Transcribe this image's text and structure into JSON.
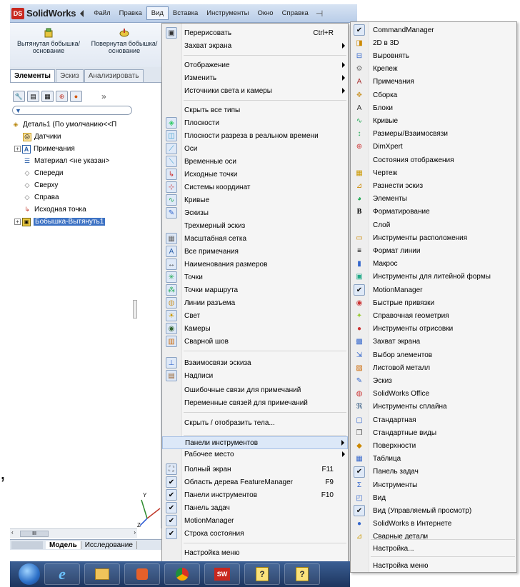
{
  "app": {
    "logo_prefix": "DS",
    "logo_name": "SolidWorks"
  },
  "menubar": {
    "items": [
      "Файл",
      "Правка",
      "Вид",
      "Вставка",
      "Инструменты",
      "Окно",
      "Справка"
    ],
    "active": "Вид"
  },
  "commands": [
    {
      "label": "Вытянутая бобышка/основание",
      "icon": "extrude-boss-icon"
    },
    {
      "label": "Повернутая бобышка/основание",
      "icon": "revolve-boss-icon"
    }
  ],
  "tabs": {
    "features": "Элементы",
    "sketch": "Эскиз",
    "analyze": "Анализировать"
  },
  "tree": {
    "root": "Деталь1  (По умолчанию<<П",
    "items": [
      {
        "label": "Датчики",
        "icon": "sensors-icon"
      },
      {
        "label": "Примечания",
        "icon": "annotations-icon"
      },
      {
        "label": "Материал <не указан>",
        "icon": "material-icon"
      },
      {
        "label": "Спереди",
        "icon": "front-plane-icon"
      },
      {
        "label": "Сверху",
        "icon": "top-plane-icon"
      },
      {
        "label": "Справа",
        "icon": "right-plane-icon"
      },
      {
        "label": "Исходная точка",
        "icon": "origin-icon"
      },
      {
        "label": "Бобышка-Вытянуть1",
        "icon": "boss-extrude-icon"
      }
    ]
  },
  "bottom_tabs": {
    "model": "Модель",
    "study": "Исследование"
  },
  "scroll_label": "III",
  "view_menu": {
    "items": [
      {
        "label": "Перерисовать",
        "shortcut": "Ctrl+R",
        "icon": "redraw-icon"
      },
      {
        "label": "Захват экрана",
        "submenu": true
      },
      {
        "label": "Отображение",
        "submenu": true
      },
      {
        "label": "Изменить",
        "submenu": true
      },
      {
        "label": "Источники света и камеры",
        "submenu": true
      },
      {
        "label": "Скрыть все типы"
      },
      {
        "label": "Плоскости",
        "icon": "planes-icon"
      },
      {
        "label": "Плоскости разреза в реальном времени",
        "icon": "section-planes-icon"
      },
      {
        "label": "Оси",
        "icon": "axes-icon"
      },
      {
        "label": "Временные оси",
        "icon": "temp-axes-icon"
      },
      {
        "label": "Исходные точки",
        "icon": "origins-icon"
      },
      {
        "label": "Системы координат",
        "icon": "coordinate-systems-icon"
      },
      {
        "label": "Кривые",
        "icon": "curves-icon"
      },
      {
        "label": "Эскизы",
        "icon": "sketches-icon"
      },
      {
        "label": "Трехмерный эскиз"
      },
      {
        "label": "Масштабная сетка",
        "icon": "grid-icon"
      },
      {
        "label": "Все примечания",
        "icon": "all-annotations-icon"
      },
      {
        "label": "Наименования размеров",
        "icon": "dimension-names-icon"
      },
      {
        "label": "Точки",
        "icon": "points-icon"
      },
      {
        "label": "Точки маршрута",
        "icon": "route-points-icon"
      },
      {
        "label": "Линии разъема",
        "icon": "parting-lines-icon"
      },
      {
        "label": "Свет",
        "icon": "lights-icon"
      },
      {
        "label": "Камеры",
        "icon": "cameras-icon"
      },
      {
        "label": "Сварной шов",
        "icon": "weld-bead-icon"
      },
      {
        "label": "Взаимосвязи эскиза",
        "icon": "sketch-relations-icon"
      },
      {
        "label": "Надписи",
        "icon": "decals-icon"
      },
      {
        "label": "Ошибочные связи для примечаний"
      },
      {
        "label": "Переменные связей для примечаний"
      },
      {
        "label": "Скрыть / отобразить тела..."
      },
      {
        "label": "Панели инструментов",
        "submenu": true,
        "highlighted": true
      },
      {
        "label": "Рабочее место",
        "submenu": true
      },
      {
        "label": "Полный экран",
        "shortcut": "F11",
        "icon": "fullscreen-icon"
      },
      {
        "label": "Область дерева FeatureManager",
        "shortcut": "F9",
        "checked": true
      },
      {
        "label": "Панели инструментов",
        "shortcut": "F10",
        "checked": true
      },
      {
        "label": "Панель задач",
        "checked": true
      },
      {
        "label": "MotionManager",
        "checked": true
      },
      {
        "label": "Строка состояния",
        "checked": true
      },
      {
        "label": "Настройка меню"
      }
    ]
  },
  "toolbars_menu": {
    "items": [
      {
        "label": "CommandManager",
        "checked": true
      },
      {
        "label": "2D в 3D",
        "icon": "2d-to-3d-icon"
      },
      {
        "label": "Выровнять",
        "icon": "align-icon"
      },
      {
        "label": "Крепеж",
        "icon": "fasteners-icon"
      },
      {
        "label": "Примечания",
        "icon": "annotation-icon"
      },
      {
        "label": "Сборка",
        "icon": "assembly-icon"
      },
      {
        "label": "Блоки",
        "icon": "blocks-icon"
      },
      {
        "label": "Кривые",
        "icon": "curves-icon"
      },
      {
        "label": "Размеры/Взаимосвязи",
        "icon": "dimensions-icon"
      },
      {
        "label": "DimXpert",
        "icon": "dimxpert-icon"
      },
      {
        "label": "Состояния отображения"
      },
      {
        "label": "Чертеж",
        "icon": "drawing-icon"
      },
      {
        "label": "Разнести эскиз",
        "icon": "explode-sketch-icon"
      },
      {
        "label": "Элементы",
        "icon": "features-icon"
      },
      {
        "label": "Форматирование",
        "icon": "formatting-icon"
      },
      {
        "label": "Слой"
      },
      {
        "label": "Инструменты расположения",
        "icon": "layout-tools-icon"
      },
      {
        "label": "Формат линии",
        "icon": "line-format-icon"
      },
      {
        "label": "Макрос",
        "icon": "macro-icon"
      },
      {
        "label": "Инструменты для литейной формы",
        "icon": "mold-tools-icon"
      },
      {
        "label": "MotionManager",
        "checked": true
      },
      {
        "label": "Быстрые привязки",
        "icon": "quick-snaps-icon"
      },
      {
        "label": "Справочная геометрия",
        "icon": "reference-geometry-icon"
      },
      {
        "label": "Инструменты отрисовки",
        "icon": "render-tools-icon"
      },
      {
        "label": "Захват экрана",
        "icon": "screen-capture-icon"
      },
      {
        "label": "Выбор элементов",
        "icon": "selection-filter-icon"
      },
      {
        "label": "Листовой металл",
        "icon": "sheet-metal-icon"
      },
      {
        "label": "Эскиз",
        "icon": "sketch-icon"
      },
      {
        "label": "SolidWorks Office",
        "icon": "solidworks-office-icon"
      },
      {
        "label": "Инструменты сплайна",
        "icon": "spline-tools-icon"
      },
      {
        "label": "Стандартная",
        "icon": "standard-icon"
      },
      {
        "label": "Стандартные виды",
        "icon": "standard-views-icon"
      },
      {
        "label": "Поверхности",
        "icon": "surfaces-icon"
      },
      {
        "label": "Таблица",
        "icon": "table-icon"
      },
      {
        "label": "Панель задач",
        "checked": true
      },
      {
        "label": "Инструменты",
        "icon": "tools-icon"
      },
      {
        "label": "Вид",
        "icon": "view-icon"
      },
      {
        "label": "Вид (Управляемый просмотр)",
        "checked": true
      },
      {
        "label": "SolidWorks в Интернете",
        "icon": "web-icon"
      },
      {
        "label": "Сварные детали",
        "icon": "weldments-icon"
      },
      {
        "label": "Настройка..."
      },
      {
        "label": "Настройка меню"
      }
    ]
  },
  "taskbar": {
    "apps": [
      "start-orb",
      "internet-explorer-icon",
      "explorer-icon",
      "media-player-icon",
      "chrome-icon",
      "solidworks-icon",
      "help-icon",
      "help-icon-2"
    ]
  },
  "triad": {
    "x": "X",
    "y": "Y",
    "z": "Z"
  }
}
